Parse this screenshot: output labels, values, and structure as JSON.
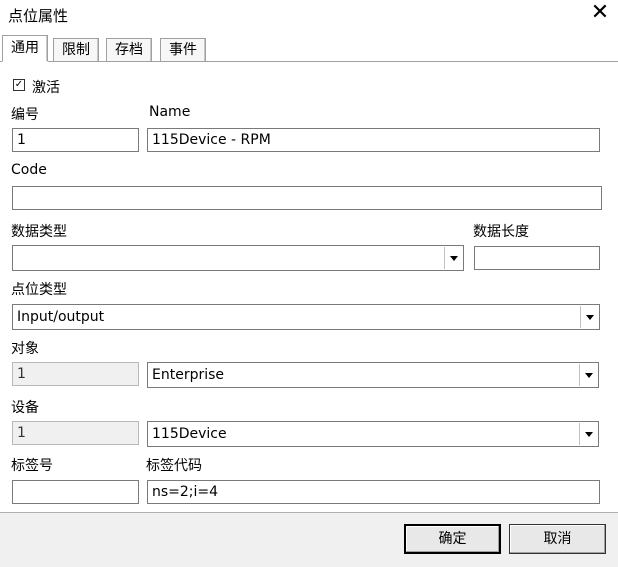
{
  "window": {
    "title": "点位属性"
  },
  "tabs": [
    {
      "label": "通用"
    },
    {
      "label": "限制"
    },
    {
      "label": "存档"
    },
    {
      "label": "事件"
    }
  ],
  "activate": {
    "label": "激活",
    "checked": true,
    "mark": "✓"
  },
  "fields": {
    "number_label": "编号",
    "number_value": "1",
    "name_label": "Name",
    "name_value": "115Device - RPM",
    "code_label": "Code",
    "code_value": "",
    "data_type_label": "数据类型",
    "data_type_value": "",
    "data_length_label": "数据长度",
    "data_length_value": "",
    "point_type_label": "点位类型",
    "point_type_value": "Input/output",
    "object_label": "对象",
    "object_id": "1",
    "object_value": "Enterprise",
    "device_label": "设备",
    "device_id": "1",
    "device_value": "115Device",
    "tag_number_label": "标签号",
    "tag_number_value": "",
    "tag_code_label": "标签代码",
    "tag_code_value": "ns=2;i=4"
  },
  "buttons": {
    "ok": "确定",
    "cancel": "取消"
  },
  "icons": {
    "close": "close-icon",
    "dropdown": "chevron-down-icon",
    "check": "checkmark-icon"
  }
}
